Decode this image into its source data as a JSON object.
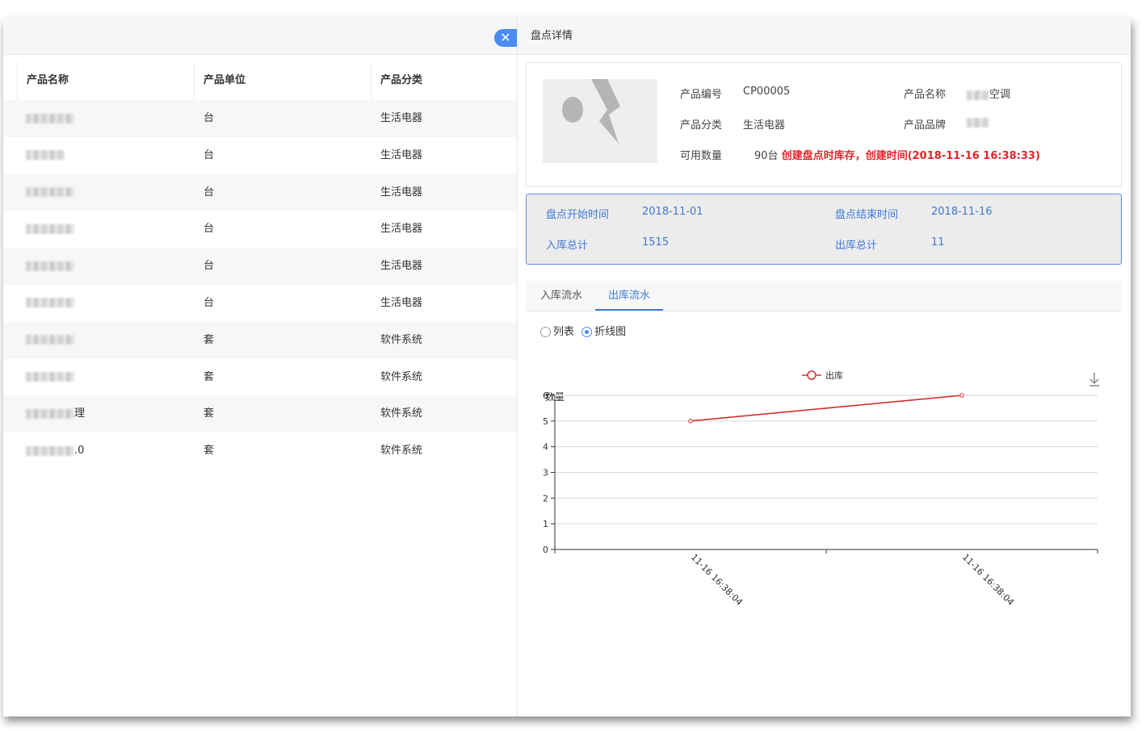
{
  "table": {
    "columns": [
      "产品名称",
      "产品单位",
      "产品分类"
    ],
    "rows": [
      {
        "name_suffix": "",
        "unit": "台",
        "category": "生活电器"
      },
      {
        "name_suffix": "",
        "unit": "台",
        "category": "生活电器"
      },
      {
        "name_suffix": "",
        "unit": "台",
        "category": "生活电器"
      },
      {
        "name_suffix": "",
        "unit": "台",
        "category": "生活电器"
      },
      {
        "name_suffix": "",
        "unit": "台",
        "category": "生活电器"
      },
      {
        "name_suffix": "",
        "unit": "台",
        "category": "生活电器"
      },
      {
        "name_suffix": "",
        "unit": "套",
        "category": "软件系统"
      },
      {
        "name_suffix": "",
        "unit": "套",
        "category": "软件系统"
      },
      {
        "name_suffix": "理",
        "unit": "套",
        "category": "软件系统"
      },
      {
        "name_suffix": ".0",
        "unit": "套",
        "category": "软件系统"
      }
    ]
  },
  "panel": {
    "title": "盘点详情",
    "close_icon": "close-icon",
    "info": {
      "code_label": "产品编号",
      "code_value": "CP00005",
      "name_label": "产品名称",
      "name_value_suffix": "空调",
      "category_label": "产品分类",
      "category_value": "生活电器",
      "brand_label": "产品品牌",
      "qty_label": "可用数量",
      "qty_value": "90台",
      "qty_note": "创建盘点时库存，创建时间(2018-11-16 16:38:33)"
    },
    "summary": {
      "start_label": "盘点开始时间",
      "start_value": "2018-11-01",
      "end_label": "盘点结束时间",
      "end_value": "2018-11-16",
      "in_label": "入库总计",
      "in_value": "1515",
      "out_label": "出库总计",
      "out_value": "11"
    },
    "tabs": [
      {
        "label": "入库流水",
        "active": false
      },
      {
        "label": "出库流水",
        "active": true
      }
    ],
    "view_mode": {
      "options": [
        "列表",
        "折线图"
      ],
      "selected": "折线图"
    },
    "download_icon": "download-icon"
  },
  "colors": {
    "accent": "#4a8bf5",
    "summary_text": "#3e7ad6",
    "line": "#d32f2f",
    "warn": "#e0262b"
  },
  "chart_data": {
    "type": "line",
    "legend": [
      "出库"
    ],
    "ylabel": "数量",
    "ylim": [
      0,
      6
    ],
    "yticks": [
      0,
      1,
      2,
      3,
      4,
      5,
      6
    ],
    "categories": [
      "11-16 16:38:04",
      "11-16 16:38:04"
    ],
    "series": [
      {
        "name": "出库",
        "values": [
          5,
          6
        ]
      }
    ],
    "grid": true,
    "legend_position": "top-center"
  }
}
